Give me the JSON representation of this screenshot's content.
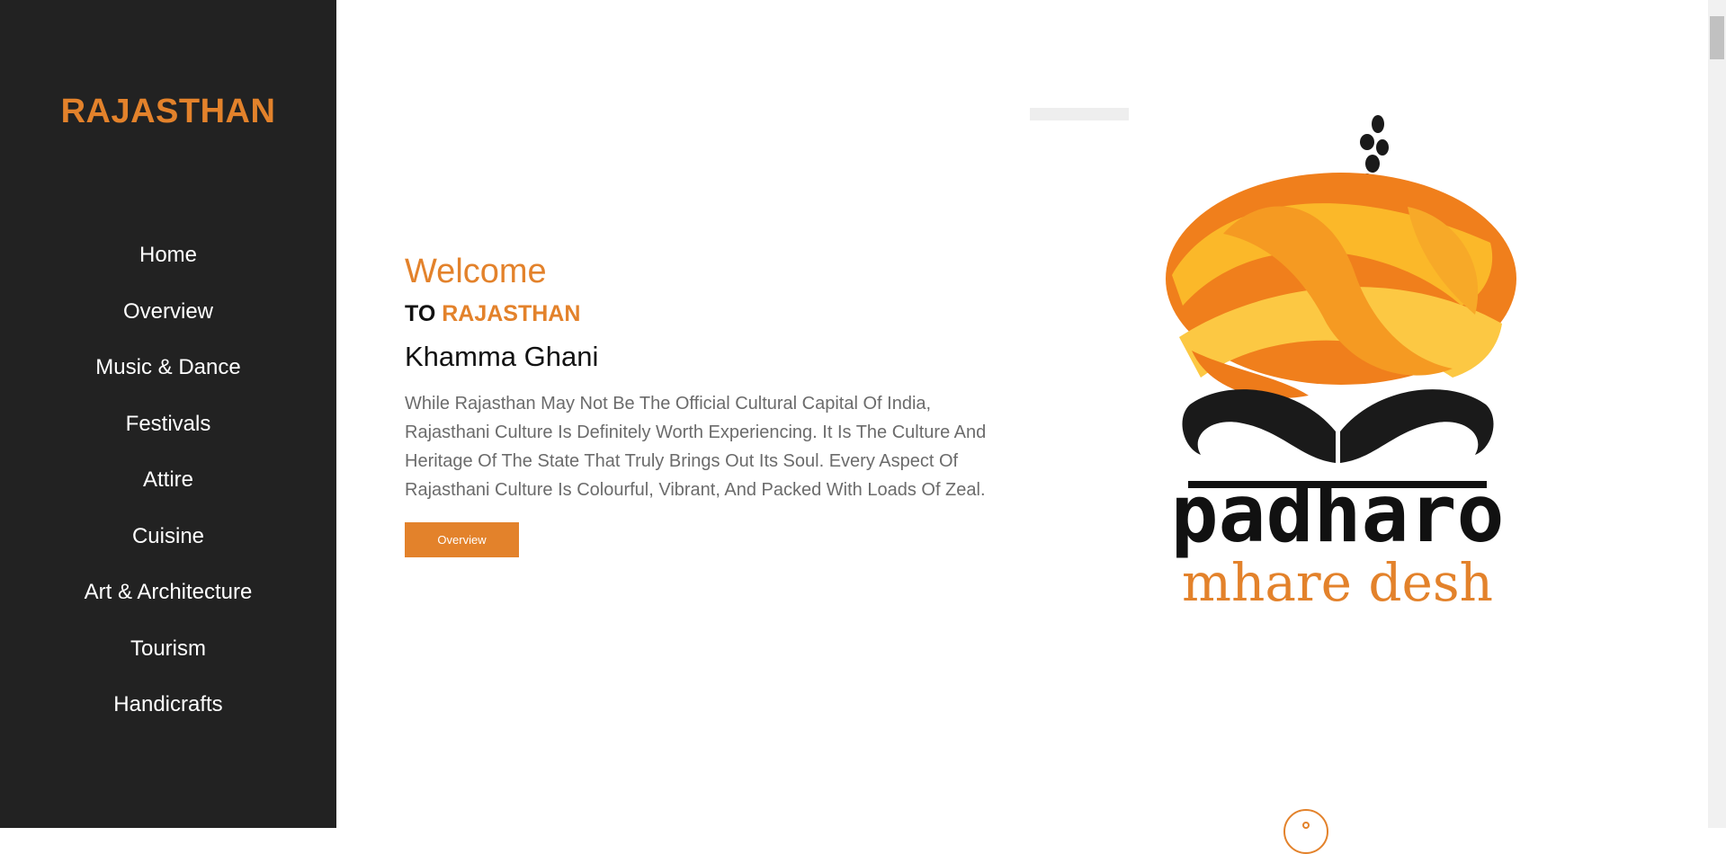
{
  "sidebar": {
    "brand": "RAJASTHAN",
    "items": [
      {
        "label": "Home"
      },
      {
        "label": "Overview"
      },
      {
        "label": "Music & Dance"
      },
      {
        "label": "Festivals"
      },
      {
        "label": "Attire"
      },
      {
        "label": "Cuisine"
      },
      {
        "label": "Art & Architecture"
      },
      {
        "label": "Tourism"
      },
      {
        "label": "Handicrafts"
      }
    ]
  },
  "hero": {
    "welcome": "Welcome",
    "to": "TO",
    "state": "RAJASTHAN",
    "greeting": "Khamma Ghani",
    "paragraph": "While Rajasthan May Not Be The Official Cultural Capital Of India, Rajasthani Culture Is Definitely Worth Experiencing. It Is The Culture And Heritage Of The State That Truly Brings Out Its Soul. Every Aspect Of Rajasthani Culture Is Colourful, Vibrant, And Packed With Loads Of Zeal.",
    "button_label": "Overview"
  },
  "logo": {
    "line1": "padharo",
    "line2": "mhare desh"
  },
  "colors": {
    "accent": "#e3822b",
    "sidebar_bg": "#222222",
    "turban_dark": "#f07f1c",
    "turban_light": "#fbb829",
    "mustache": "#1a1a1a"
  }
}
